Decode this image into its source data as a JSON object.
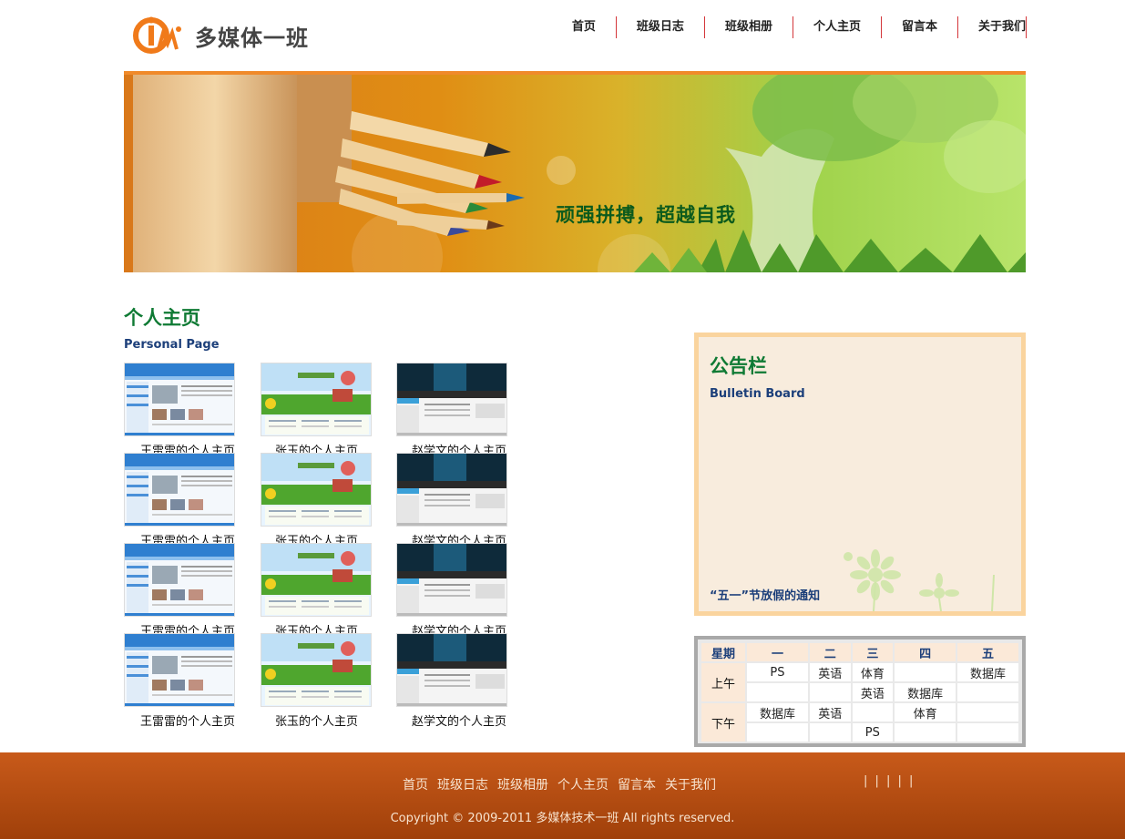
{
  "header": {
    "logo_text": "多媒体一班",
    "nav": [
      "首页",
      "班级日志",
      "班级相册",
      "个人主页",
      "留言本",
      "关于我们"
    ]
  },
  "banner": {
    "slogan": "顽强拼搏，超越自我"
  },
  "main": {
    "title": "个人主页",
    "subtitle": "Personal Page",
    "gallery": [
      [
        "王雷雷的个人主页",
        "张玉的个人主页",
        "赵学文的个人主页"
      ],
      [
        "王雷雷的个人主页",
        "张玉的个人主页",
        "赵学文的个人主页"
      ],
      [
        "王雷雷的个人主页",
        "张玉的个人主页",
        "赵学文的个人主页"
      ],
      [
        "王雷雷的个人主页",
        "张玉的个人主页",
        "赵学文的个人主页"
      ]
    ]
  },
  "bulletin": {
    "title": "公告栏",
    "subtitle": "Bulletin Board",
    "notice": "“五一”节放假的通知"
  },
  "schedule": {
    "header": [
      "星期",
      "一",
      "二",
      "三",
      "四",
      "五"
    ],
    "morning_label": "上午",
    "afternoon_label": "下午",
    "rows": [
      [
        "PS",
        "英语",
        "体育",
        "",
        "数据库"
      ],
      [
        "",
        "",
        "英语",
        "数据库",
        ""
      ],
      [
        "数据库",
        "英语",
        "",
        "体育",
        ""
      ],
      [
        "",
        "",
        "PS",
        "",
        ""
      ]
    ]
  },
  "footer": {
    "nav": [
      "首页",
      "班级日志",
      "班级相册",
      "个人主页",
      "留言本",
      "关于我们"
    ],
    "bars": "| | | | |",
    "copyright": "Copyright © 2009-2011 多媒体技术一班 All rights reserved."
  },
  "colors": {
    "accent_green": "#0f7a34",
    "accent_blue": "#1c3f7a",
    "footer_orange": "#c85a1a",
    "nav_divider": "#d4363a"
  }
}
